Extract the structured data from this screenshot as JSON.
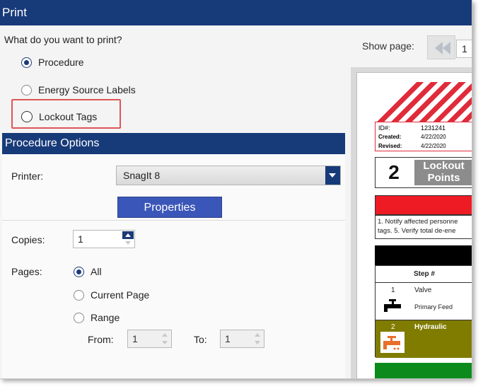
{
  "window": {
    "title": "Print"
  },
  "print_what": {
    "question": "What do you want to print?",
    "options": [
      {
        "label": "Procedure",
        "selected": true
      },
      {
        "label": "Energy Source Labels",
        "selected": false
      },
      {
        "label": "Lockout Tags",
        "selected": false,
        "highlighted": true
      }
    ]
  },
  "procedure_options": {
    "header": "Procedure Options",
    "printer": {
      "label": "Printer:",
      "value": "SnagIt 8"
    },
    "properties_button": "Properties",
    "copies": {
      "label": "Copies:",
      "value": "1"
    },
    "pages": {
      "label": "Pages:",
      "options": [
        {
          "label": "All",
          "selected": true
        },
        {
          "label": "Current Page",
          "selected": false
        },
        {
          "label": "Range",
          "selected": false
        }
      ],
      "from_label": "From:",
      "from_value": "1",
      "to_label": "To:",
      "to_value": "1"
    }
  },
  "preview": {
    "show_page_label": "Show page:",
    "page_value": "1",
    "document": {
      "id_label": "ID#:",
      "id_value": "1231241",
      "created_label": "Created:",
      "created_value": "4/22/2020",
      "revised_label": "Revised:",
      "revised_value": "4/22/2020",
      "lockout_count": "2",
      "lockout_line1": "Lockout",
      "lockout_line2": "Points",
      "notes_line1": "1. Notify affected personne",
      "notes_line2": "tags. 5. Verify total de-ene",
      "step_header": "Step #",
      "steps": [
        {
          "num": "1",
          "name": "Valve",
          "sub": "Primary Feed"
        },
        {
          "num": "2",
          "name": "Hydraulic",
          "sub": ""
        }
      ]
    }
  },
  "colors": {
    "titlebar": "#173a79",
    "accent_button": "#3a56b8",
    "highlight_box": "#e05454",
    "doc_red": "#ee1b24",
    "doc_olive": "#807c00",
    "doc_green": "#0c8a1c"
  }
}
